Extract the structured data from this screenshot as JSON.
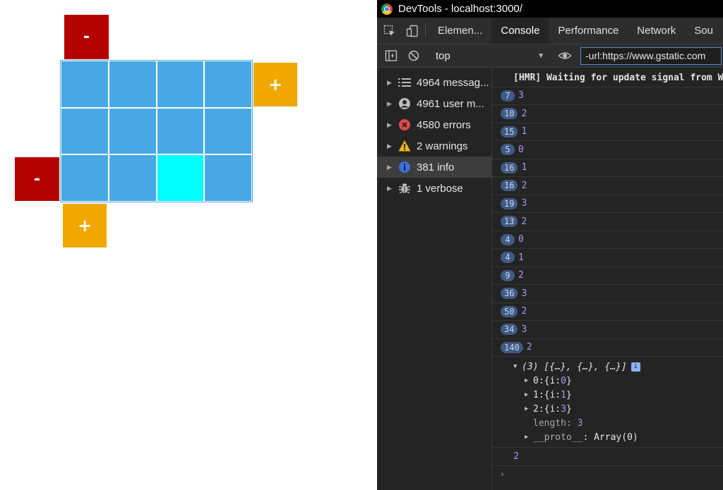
{
  "app": {
    "controls": {
      "top_minus": "-",
      "left_minus": "-",
      "right_plus": "+",
      "bottom_plus": "+"
    },
    "grid": {
      "rows": 3,
      "columns": 4,
      "active_cell": {
        "row": 3,
        "column": 3
      },
      "colors": {
        "cell": "#47a8e6",
        "active": "#00ffff",
        "minus": "#b50000",
        "plus": "#f0a800"
      }
    }
  },
  "devtools": {
    "window_title": "DevTools - localhost:3000/",
    "tabs": [
      {
        "label": "Elemen..."
      },
      {
        "label": "Console"
      },
      {
        "label": "Performance"
      },
      {
        "label": "Network"
      },
      {
        "label": "Sou"
      }
    ],
    "active_tab": "Console",
    "toolbar": {
      "context": "top",
      "filter_value": "-url:https://www.gstatic.com"
    },
    "sidebar": [
      {
        "label": "4964 messag...",
        "icon": "list-icon"
      },
      {
        "label": "4961 user m...",
        "icon": "user-icon"
      },
      {
        "label": "4580 errors",
        "icon": "error-icon"
      },
      {
        "label": "2 warnings",
        "icon": "warning-icon"
      },
      {
        "label": "381 info",
        "icon": "info-icon"
      },
      {
        "label": "1 verbose",
        "icon": "bug-icon"
      }
    ],
    "selected_sidebar": "381 info",
    "console": {
      "hmr_message": "[HMR] Waiting for update signal from WDS...",
      "log_rows": [
        {
          "count": "7",
          "value": "3"
        },
        {
          "count": "10",
          "value": "2"
        },
        {
          "count": "15",
          "value": "1"
        },
        {
          "count": "5",
          "value": "0"
        },
        {
          "count": "16",
          "value": "1"
        },
        {
          "count": "16",
          "value": "2"
        },
        {
          "count": "19",
          "value": "3"
        },
        {
          "count": "13",
          "value": "2"
        },
        {
          "count": "4",
          "value": "0"
        },
        {
          "count": "4",
          "value": "1"
        },
        {
          "count": "9",
          "value": "2"
        },
        {
          "count": "36",
          "value": "3"
        },
        {
          "count": "50",
          "value": "2"
        },
        {
          "count": "34",
          "value": "3"
        },
        {
          "count": "140",
          "value": "2"
        }
      ],
      "array": {
        "summary": "(3) [{…}, {…}, {…}]",
        "items": [
          {
            "key": "0:",
            "prefix": " {i: ",
            "value": "0",
            "suffix": "}"
          },
          {
            "key": "1:",
            "prefix": " {i: ",
            "value": "1",
            "suffix": "}"
          },
          {
            "key": "2:",
            "prefix": " {i: ",
            "value": "3",
            "suffix": "}"
          }
        ],
        "length_key": "length",
        "length_value": "3",
        "proto_key": "__proto__",
        "proto_value": "Array(0)"
      },
      "result_value": "2",
      "prompt": "›"
    }
  }
}
